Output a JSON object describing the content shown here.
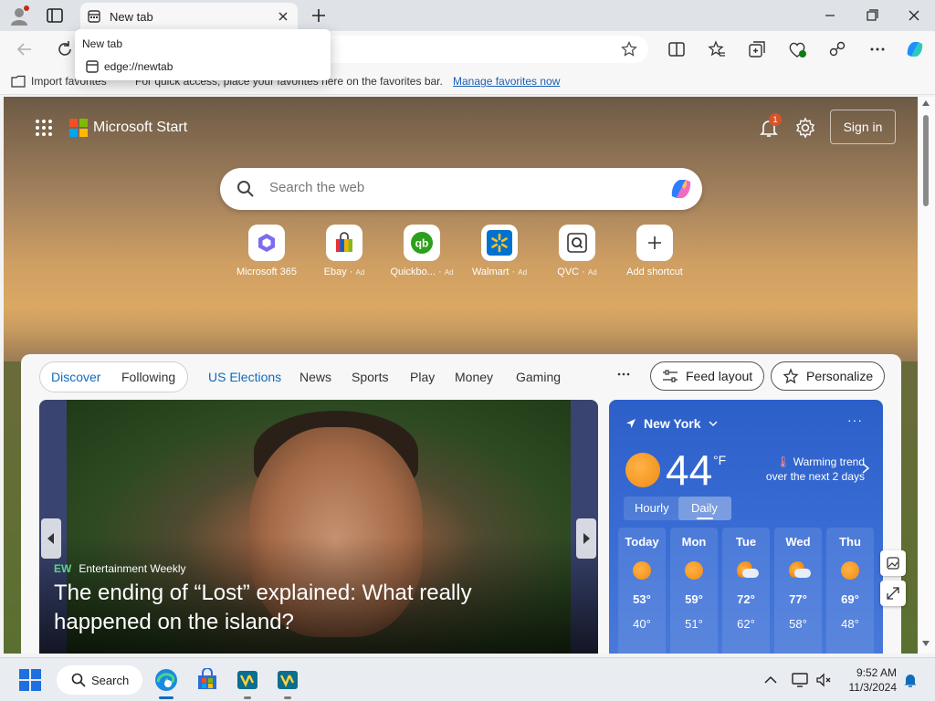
{
  "browser": {
    "tab_title": "New tab",
    "tooltip_title": "New tab",
    "tooltip_url": "edge://newtab"
  },
  "favorites_bar": {
    "import_label": "Import favorites",
    "prompt_text": "For quick access, place your favorites here on the favorites bar.",
    "manage_link": "Manage favorites now"
  },
  "header": {
    "brand": "Microsoft Start",
    "notification_count": "1",
    "signin_label": "Sign in"
  },
  "search": {
    "placeholder": "Search the web"
  },
  "shortcuts": [
    {
      "label": "Microsoft 365",
      "ad": "",
      "icon": "microsoft-365-icon"
    },
    {
      "label": "Ebay",
      "ad": "Ad",
      "icon": "ebay-icon"
    },
    {
      "label": "Quickbo...",
      "ad": "Ad",
      "icon": "quickbooks-icon"
    },
    {
      "label": "Walmart",
      "ad": "Ad",
      "icon": "walmart-icon"
    },
    {
      "label": "QVC",
      "ad": "Ad",
      "icon": "qvc-icon"
    },
    {
      "label": "Add shortcut",
      "ad": "",
      "icon": "plus-icon"
    }
  ],
  "feed_nav": {
    "discover": "Discover",
    "following": "Following",
    "items": [
      "US Elections",
      "News",
      "Sports",
      "Play",
      "Money",
      "Gaming"
    ],
    "feed_layout": "Feed layout",
    "personalize": "Personalize"
  },
  "hero": {
    "source_logo": "EW",
    "source": "Entertainment Weekly",
    "title": "The ending of “Lost” explained: What really happened on the island?"
  },
  "weather": {
    "location": "New York",
    "temperature": "44",
    "unit": "°F",
    "trend_line1": "Warming trend",
    "trend_line2": "over the next 2 days",
    "tab_hourly": "Hourly",
    "tab_daily": "Daily",
    "days": [
      {
        "name": "Today",
        "hi": "53°",
        "lo": "40°",
        "icon": "sunny-icon"
      },
      {
        "name": "Mon",
        "hi": "59°",
        "lo": "51°",
        "icon": "sunny-icon"
      },
      {
        "name": "Tue",
        "hi": "72°",
        "lo": "62°",
        "icon": "partly-cloudy-icon"
      },
      {
        "name": "Wed",
        "hi": "77°",
        "lo": "58°",
        "icon": "partly-cloudy-icon"
      },
      {
        "name": "Thu",
        "hi": "69°",
        "lo": "48°",
        "icon": "sunny-icon"
      }
    ]
  },
  "taskbar": {
    "search_label": "Search",
    "time": "9:52 AM",
    "date": "11/3/2024"
  },
  "colors": {
    "accent": "#0f6cbd",
    "weather_bg": "#2c5fc8",
    "notification_badge": "#d9532a"
  }
}
